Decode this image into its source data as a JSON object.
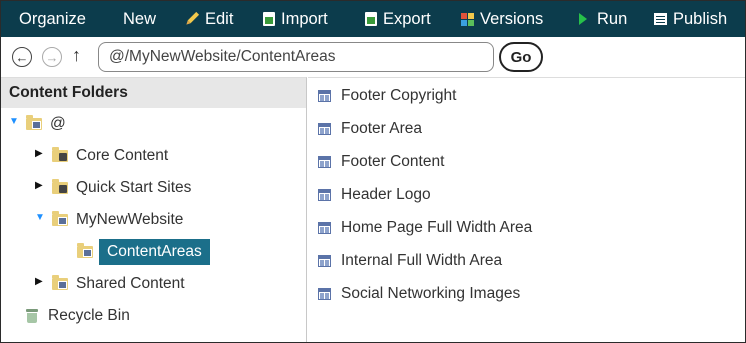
{
  "toolbar": {
    "items": [
      {
        "label": "Organize",
        "icon": null
      },
      {
        "label": "New",
        "icon": null
      },
      {
        "label": "Edit",
        "icon": "pencil-icon"
      },
      {
        "label": "Import",
        "icon": "import-icon"
      },
      {
        "label": "Export",
        "icon": "export-icon"
      },
      {
        "label": "Versions",
        "icon": "versions-icon"
      },
      {
        "label": "Run",
        "icon": "play-icon"
      },
      {
        "label": "Publish",
        "icon": "publish-icon"
      }
    ],
    "background": "#0c3c4c"
  },
  "address": {
    "path": "@/MyNewWebsite/ContentAreas",
    "go_label": "Go"
  },
  "left": {
    "header": "Content Folders",
    "tree": {
      "root": "@",
      "core": "Core Content",
      "quick": "Quick Start Sites",
      "mynew": "MyNewWebsite",
      "content_areas": "ContentAreas",
      "shared": "Shared Content",
      "recycle": "Recycle Bin"
    },
    "selected_color": "#1b6f8a"
  },
  "right": {
    "items": [
      "Footer Copyright",
      "Footer Area",
      "Footer Content",
      "Header Logo",
      "Home Page Full Width Area",
      "Internal Full Width Area",
      "Social Networking Images"
    ]
  }
}
